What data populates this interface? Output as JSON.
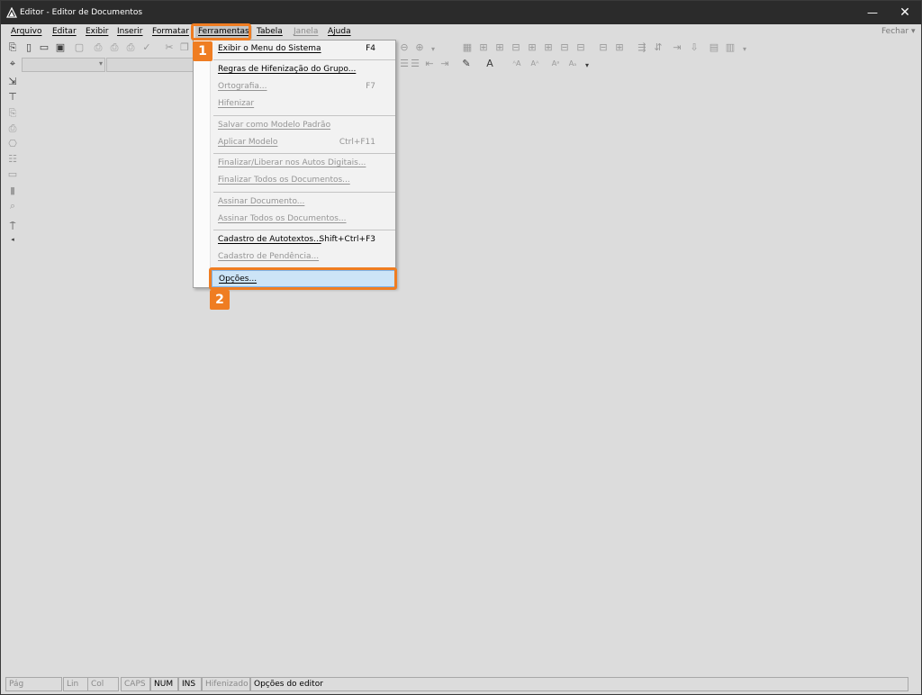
{
  "window": {
    "title": "Editor - Editor de Documentos",
    "minimize_glyph": "—",
    "close_glyph": "✕"
  },
  "menubar": {
    "items": [
      {
        "label": "Arquivo",
        "enabled": true
      },
      {
        "label": "Editar",
        "enabled": true
      },
      {
        "label": "Exibir",
        "enabled": true
      },
      {
        "label": "Inserir",
        "enabled": true
      },
      {
        "label": "Formatar",
        "enabled": true
      },
      {
        "label": "Ferramentas",
        "enabled": true,
        "open": true
      },
      {
        "label": "Tabela",
        "enabled": true
      },
      {
        "label": "Janela",
        "enabled": false
      },
      {
        "label": "Ajuda",
        "enabled": true
      }
    ],
    "fechar": "Fechar"
  },
  "dropdown": {
    "items": [
      {
        "label": "Exibir o Menu do Sistema",
        "shortcut": "F4",
        "enabled": true
      },
      {
        "label": "Regras de Hifenização do Grupo...",
        "shortcut": "",
        "enabled": true
      },
      {
        "label": "Ortografia...",
        "shortcut": "F7",
        "enabled": false
      },
      {
        "label": "Hifenizar",
        "shortcut": "",
        "enabled": false
      },
      {
        "label": "Salvar como Modelo Padrão",
        "shortcut": "",
        "enabled": false
      },
      {
        "label": "Aplicar Modelo",
        "shortcut": "Ctrl+F11",
        "enabled": false
      },
      {
        "label": "Finalizar/Liberar nos Autos Digitais...",
        "shortcut": "",
        "enabled": false
      },
      {
        "label": "Finalizar Todos os Documentos...",
        "shortcut": "",
        "enabled": false
      },
      {
        "label": "Assinar Documento...",
        "shortcut": "",
        "enabled": false
      },
      {
        "label": "Assinar Todos os Documentos...",
        "shortcut": "",
        "enabled": false
      },
      {
        "label": "Cadastro de Autotextos...",
        "shortcut": "Shift+Ctrl+F3",
        "enabled": true
      },
      {
        "label": "Cadastro de Pendência...",
        "shortcut": "",
        "enabled": false
      },
      {
        "label": "Opções...",
        "shortcut": "",
        "enabled": true,
        "highlighted": true
      }
    ]
  },
  "callouts": {
    "one": "1",
    "two": "2"
  },
  "statusbar": {
    "pag": "Pág",
    "lin": "Lin",
    "col": "Col",
    "caps": "CAPS",
    "num": "NUM",
    "ins": "INS",
    "hifenizado": "Hifenizado",
    "message": "Opções do editor"
  },
  "colors": {
    "accent": "#ef7d22",
    "highlight": "#cce4f7",
    "titlebar": "#2b2b2b",
    "background": "#dcdcdc"
  }
}
